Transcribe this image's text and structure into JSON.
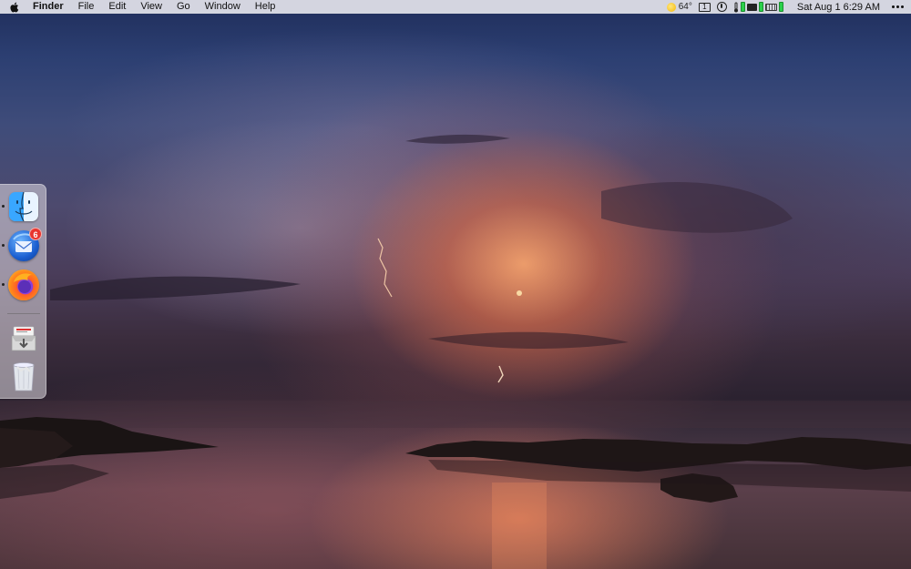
{
  "menubar": {
    "apple_icon": "apple-logo-icon",
    "app_name": "Finder",
    "menus": [
      "File",
      "Edit",
      "View",
      "Go",
      "Window",
      "Help"
    ],
    "status": {
      "weather_icon": "sun-icon",
      "temperature": "64°",
      "calendar_badge": "1",
      "clock": "Sat Aug 1  6:29 AM"
    }
  },
  "dock": {
    "items": [
      {
        "name": "Finder",
        "icon": "finder-icon",
        "running": true
      },
      {
        "name": "Thunderbird",
        "icon": "thunderbird-icon",
        "running": true,
        "badge": "6"
      },
      {
        "name": "Firefox",
        "icon": "firefox-icon",
        "running": true
      },
      {
        "name": "Downloads",
        "icon": "downloads-icon",
        "running": false
      },
      {
        "name": "Trash",
        "icon": "trash-icon",
        "running": false
      }
    ]
  },
  "desktop": {
    "wallpaper": "stormy-sunset-lightning-over-water"
  },
  "colors": {
    "menubar_bg": "#e4e4ec",
    "badge_red": "#e8352f",
    "battery_green": "#2bd14a"
  }
}
